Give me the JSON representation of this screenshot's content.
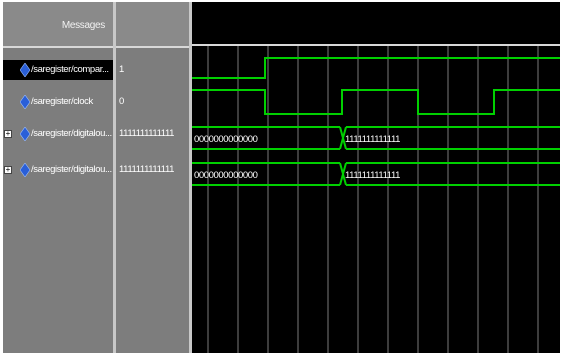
{
  "header": {
    "messages_label": "Messages"
  },
  "signals": [
    {
      "name": "/saregister/compar...",
      "value": "1",
      "type": "bit",
      "selected": true,
      "expandable": false
    },
    {
      "name": "/saregister/clock",
      "value": "0",
      "type": "bit",
      "selected": false,
      "expandable": false
    },
    {
      "name": "/saregister/digitalou...",
      "value": "1111111111111",
      "type": "bus",
      "selected": false,
      "expandable": true
    },
    {
      "name": "/saregister/digitalou...",
      "value": "1111111111111",
      "type": "bus",
      "selected": false,
      "expandable": true
    }
  ],
  "waves": {
    "bus1_labels": [
      "0000000000000",
      "1111111111111"
    ],
    "bus2_labels": [
      "0000000000000",
      "1111111111111"
    ]
  },
  "colors": {
    "wave": "#00d000",
    "grid": "#7a7a7a",
    "diamond": "#2a5fd8"
  },
  "icons": {
    "signal_icon": "diamond-icon",
    "expand_icon": "plus-icon"
  }
}
